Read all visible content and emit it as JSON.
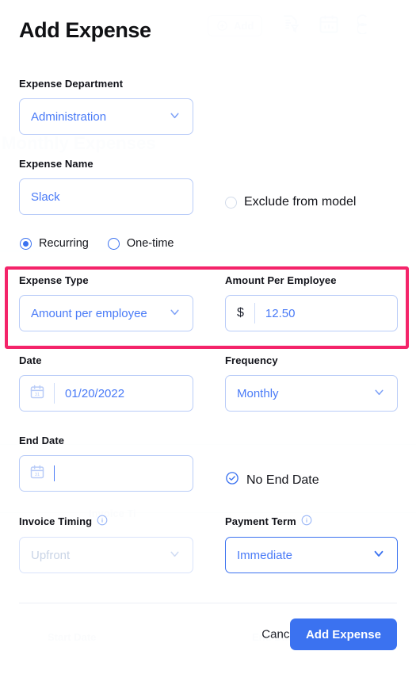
{
  "background": {
    "add_chip_label": "Add",
    "heading": "Monthly Expenses",
    "col_start_date": "Start Date",
    "col_end_date": "End Date",
    "col_invoice": "Invoice Ti"
  },
  "modal": {
    "title": "Add Expense",
    "fields": {
      "department": {
        "label": "Expense Department",
        "value": "Administration",
        "icon": "chevron-down-icon"
      },
      "expense_name": {
        "label": "Expense Name",
        "value": "Slack"
      },
      "exclude_from_model": {
        "label": "Exclude from model",
        "checked": false
      },
      "billing_mode": {
        "options": [
          {
            "label": "Recurring",
            "selected": true
          },
          {
            "label": "One-time",
            "selected": false
          }
        ]
      },
      "expense_type": {
        "label": "Expense Type",
        "value": "Amount per employee",
        "icon": "chevron-down-icon"
      },
      "amount_per_employee": {
        "label": "Amount Per Employee",
        "currency_symbol": "$",
        "value": "12.50"
      },
      "date": {
        "label": "Date",
        "value": "01/20/2022",
        "icon": "calendar-icon"
      },
      "frequency": {
        "label": "Frequency",
        "value": "Monthly",
        "icon": "chevron-down-icon"
      },
      "end_date": {
        "label": "End Date",
        "value": "",
        "icon": "calendar-icon"
      },
      "no_end_date": {
        "label": "No End Date",
        "checked": true
      },
      "invoice_timing": {
        "label": "Invoice Timing",
        "value": "Upfront",
        "disabled": true,
        "info_icon": "info-icon"
      },
      "payment_term": {
        "label": "Payment Term",
        "value": "Immediate",
        "disabled": false,
        "info_icon": "info-icon"
      }
    },
    "footer": {
      "cancel_label": "Cancel",
      "submit_label": "Add Expense"
    }
  },
  "highlight": {
    "color": "#f4246a",
    "targets": [
      "expense_type",
      "amount_per_employee"
    ]
  },
  "colors": {
    "accent_blue": "#3b72f0",
    "field_text_blue": "#4a7bf7",
    "field_border": "#b9ccf8",
    "highlight_pink": "#f4246a",
    "text_dark": "#101114"
  }
}
